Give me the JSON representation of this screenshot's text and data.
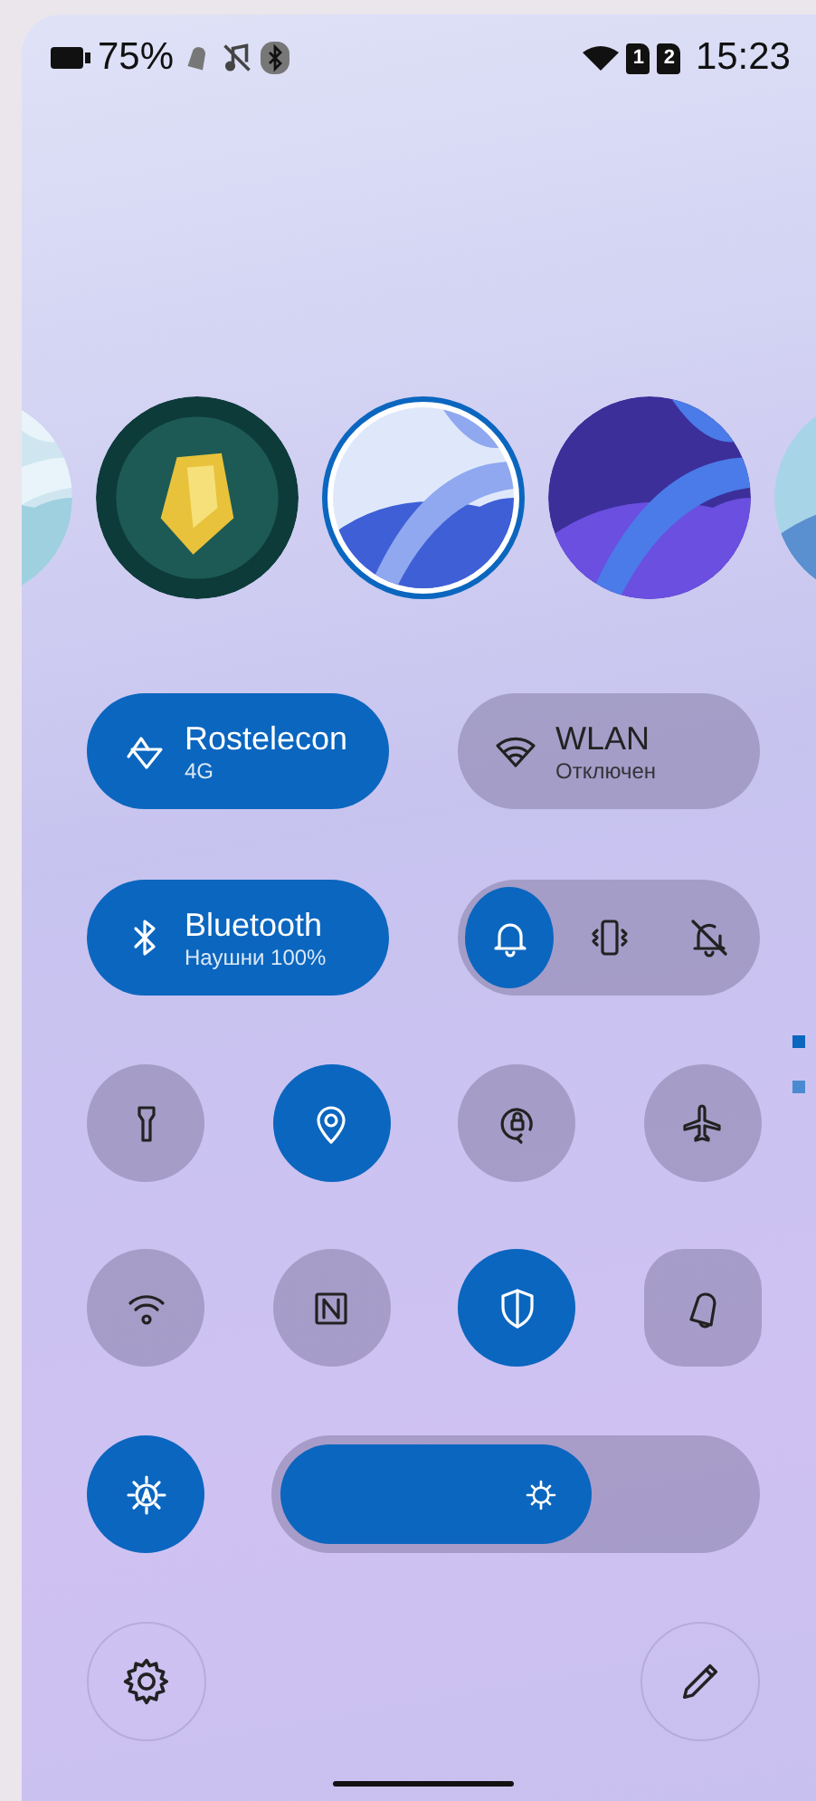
{
  "status_bar": {
    "battery": "75%",
    "sim_slots": [
      "1",
      "2"
    ],
    "time": "15:23"
  },
  "wallpapers": [
    {
      "kind": "picture",
      "selected": false
    },
    {
      "kind": "picture",
      "selected": false
    },
    {
      "kind": "picture",
      "selected": true
    },
    {
      "kind": "picture",
      "selected": false
    },
    {
      "kind": "picture",
      "selected": false
    }
  ],
  "large_tiles": [
    {
      "kind": "toggle",
      "title": "Rostelecon",
      "subtitle": "4G",
      "on": true
    },
    {
      "kind": "toggle",
      "title": "WLAN",
      "subtitle": "Отключен",
      "on": false
    },
    {
      "kind": "toggle",
      "title": "Bluetooth",
      "subtitle": "Наушни",
      "extra": "100%",
      "on": true
    },
    {
      "kind": "sound_mode",
      "modes": [
        {
          "selected": true
        },
        {
          "selected": false
        },
        {
          "selected": false
        }
      ]
    }
  ],
  "small_tiles": [
    {
      "kind": "round",
      "on": false
    },
    {
      "kind": "round",
      "on": true
    },
    {
      "kind": "round",
      "on": false
    },
    {
      "kind": "round",
      "on": false
    },
    {
      "kind": "round",
      "on": false
    },
    {
      "kind": "round",
      "on": false
    },
    {
      "kind": "round",
      "on": true
    },
    {
      "kind": "square",
      "on": false
    }
  ],
  "pager": [
    {
      "selected": true
    },
    {
      "selected": false
    }
  ],
  "brightness": {
    "auto_on": true,
    "level": 0.66
  }
}
